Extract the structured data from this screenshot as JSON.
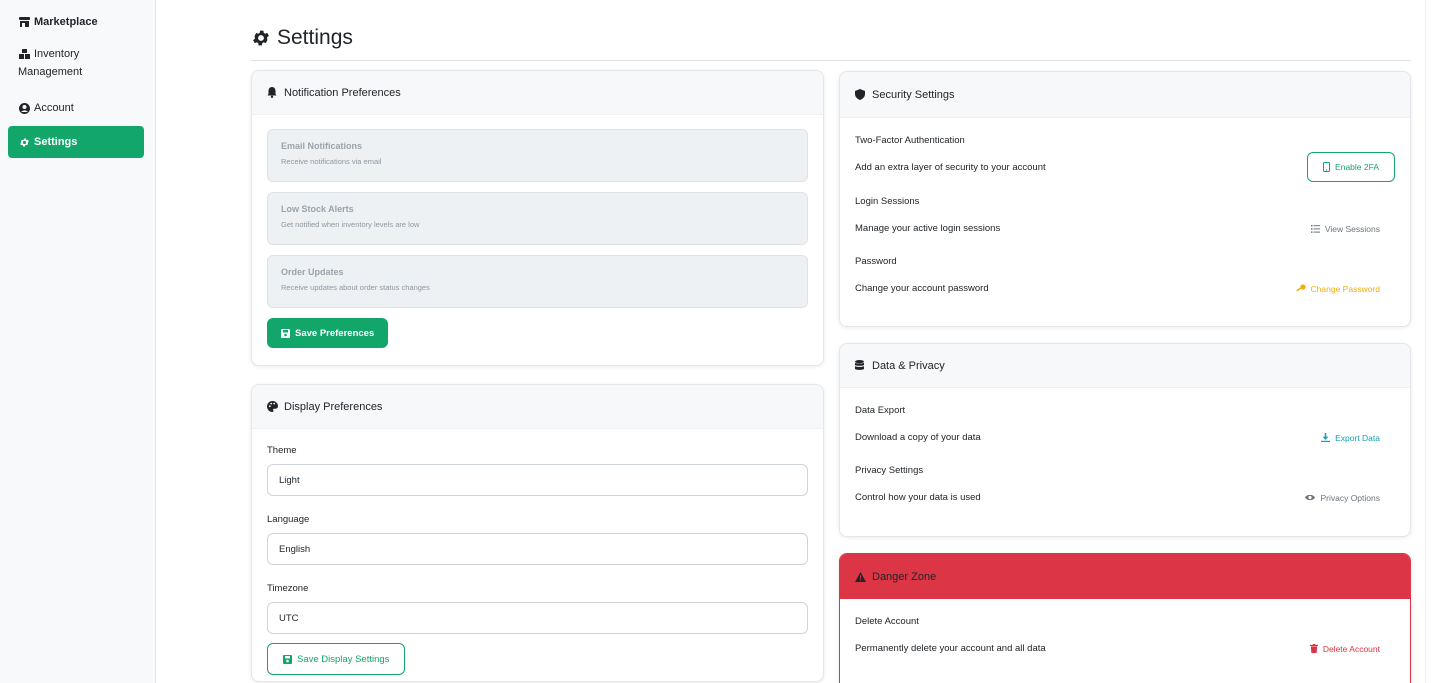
{
  "sidebar": {
    "items": [
      {
        "label": "Marketplace",
        "icon": "store-icon"
      },
      {
        "label_line1": "Inventory",
        "label_line2": "Management",
        "icon": "boxes-icon"
      },
      {
        "label": "Account",
        "icon": "user-circle-icon"
      },
      {
        "label": "Settings",
        "icon": "gear-icon",
        "active": true
      }
    ]
  },
  "page": {
    "title": "Settings"
  },
  "notifications": {
    "header": "Notification Preferences",
    "items": [
      {
        "title": "Email Notifications",
        "desc": "Receive notifications via email"
      },
      {
        "title": "Low Stock Alerts",
        "desc": "Get notified when inventory levels are low"
      },
      {
        "title": "Order Updates",
        "desc": "Receive updates about order status changes"
      }
    ],
    "save_label": "Save Preferences"
  },
  "display": {
    "header": "Display Preferences",
    "theme_label": "Theme",
    "theme_value": "Light",
    "language_label": "Language",
    "language_value": "English",
    "timezone_label": "Timezone",
    "timezone_value": "UTC",
    "save_label": "Save Display Settings"
  },
  "security": {
    "header": "Security Settings",
    "two_factor_title": "Two-Factor Authentication",
    "two_factor_desc": "Add an extra layer of security to your account",
    "two_factor_button": "Enable 2FA",
    "sessions_title": "Login Sessions",
    "sessions_desc": "Manage your active login sessions",
    "sessions_button": "View Sessions",
    "password_title": "Password",
    "password_desc": "Change your account password",
    "password_button": "Change Password"
  },
  "privacy": {
    "header": "Data & Privacy",
    "export_title": "Data Export",
    "export_desc": "Download a copy of your data",
    "export_button": "Export Data",
    "privacy_title": "Privacy Settings",
    "privacy_desc": "Control how your data is used",
    "privacy_button": "Privacy Options"
  },
  "danger": {
    "header": "Danger Zone",
    "delete_title": "Delete Account",
    "delete_desc": "Permanently delete your account and all data",
    "delete_button": "Delete Account"
  },
  "colors": {
    "accent": "#12a66a",
    "danger": "#dc3545",
    "warning": "#f0ad0e",
    "info": "#17a2b8",
    "muted": "#6c757d"
  }
}
